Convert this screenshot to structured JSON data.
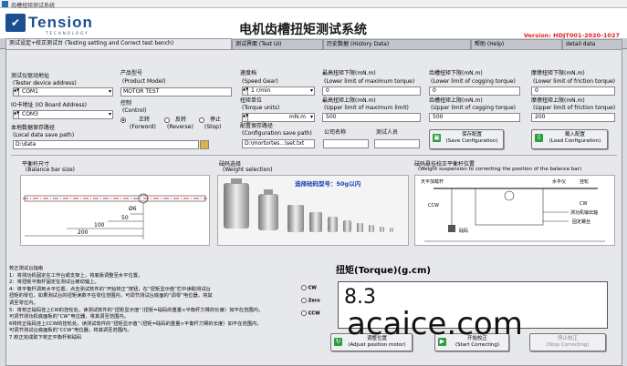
{
  "window": {
    "title": "齿槽扭矩测试系统"
  },
  "header": {
    "logo_text": "Tension",
    "logo_sub": "TECHNOLOGY",
    "app_title": "电机齿槽扭矩测试系统",
    "version": "Version: HDJT001-2020-1027"
  },
  "tabs": [
    {
      "label": "测试设定+校正测试台 (Testing setting and Correct test bench)"
    },
    {
      "label": "测试界面 (Test UI)"
    },
    {
      "label": "历史数据 (History Data)"
    },
    {
      "label": "帮助 (Help)"
    },
    {
      "label": "detail data"
    }
  ],
  "settings": {
    "tester_label_cn": "测试仪驱动地址",
    "tester_label_en": "(Tester device address)",
    "tester_value": "COM1",
    "io_label_cn": "IO卡地址 (IO Board Address)",
    "io_value": "COM3",
    "save_path_label_cn": "本地数据保存路径",
    "save_path_label_en": "(Local data save path)",
    "save_path_value": "D:\\data",
    "product_label": "产品型号",
    "product_label_en": "(Product Model)",
    "product_value": "MOTOR TEST",
    "control_label": "控制",
    "control_label_en": "(Control)",
    "forward_label": "正转",
    "forward_en": "(Forword)",
    "reverse_label": "反转",
    "reverse_en": "(Reverse)",
    "stop_label": "停止",
    "stop_en": "(Stop)",
    "speed_label": "速度档",
    "speed_en": "(Speed Gear)",
    "speed_value": "1 r/min",
    "torque_unit_label": "扭矩单位",
    "torque_unit_en": "(Torque units)",
    "torque_unit_value": "mN.m",
    "config_path_label": "配置保存路径",
    "config_path_en": "(Configuration save path)",
    "config_path_value": "D:\\mortortes...\\set.txt",
    "company_label": "公司名称",
    "tester_person_label": "测试人员",
    "max_lower_label": "最高扭矩下限(mN.m)",
    "max_lower_en": "(Lower limit of maximum torque)",
    "max_lower_value": "0",
    "max_upper_label": "最高扭矩上限(mN.m)",
    "max_upper_en": "(Upper limit of maximum limit)",
    "max_upper_value": "500",
    "cog_lower_label": "齿槽扭矩下限(mN.m)",
    "cog_lower_en": "(Lower limit of cogging torque)",
    "cog_lower_value": "0",
    "cog_upper_label": "齿槽扭矩上限(mN.m)",
    "cog_upper_en": "(Upper limit of cogging torque)",
    "cog_upper_value": "500",
    "fric_lower_label": "摩擦扭矩下限(mN.m)",
    "fric_lower_en": "(Lower limit of friction torque)",
    "fric_lower_value": "0",
    "fric_upper_label": "摩擦扭矩上限(mN.m)",
    "fric_upper_en": "(Upper limit of friction torque)",
    "fric_upper_value": "200",
    "save_config_cn": "保存配置",
    "save_config_en": "(Save Configuration)",
    "load_config_cn": "载入配置",
    "load_config_en": "(Load Configuration)"
  },
  "diagrams": {
    "bar_title_cn": "平衡杆尺寸",
    "bar_title_en": "(Balance bar size)",
    "dim_6": "Ø6",
    "dim_50": "50",
    "dim_100": "100",
    "dim_200": "200",
    "weight_title_cn": "砝码选择",
    "weight_title_en": "(Weight selection)",
    "weight_caption": "选择砝码型号：50g以内",
    "susp_title_cn": "砝码悬挂校正平衡杆位置",
    "susp_title_en": "(Weight suspension to correcting the position of the balance bar)",
    "susp_l1": "天平加载杆",
    "susp_l2": "水平仪",
    "susp_l3": "挂轮",
    "susp_l4": "CCW",
    "susp_l5": "CW",
    "susp_l6": "测功机输出轴",
    "susp_l7": "固定螺丝",
    "susp_l8": "砝码"
  },
  "instructions": {
    "title": "校正测试台指南",
    "lines": [
      "1：将测功机固定在工作台或支架上，将底板调整至水平位置。",
      "2：将扭矩平衡杆固定在测试台被动轴上。",
      "4：将平衡杆调到水平位置，点击测试软件的“开始校正”按钮，在“扭矩显示值”栏中读取测试台",
      "扭矩的零位，如果测试台的扭矩读数不在零位范围内，可调节测试台底面的“调零”电位器，将其",
      "调至零位内。",
      "5：将校正砝码挂上CW的挂轮处，读测试软件的“扭矩显示值”（扭矩=砝码的重量×平衡杆力臂的长度）如不在范围内，",
      "可调节测功机底面板的“CW”电位器，将其调至范围内。",
      "6将校正砝码挂上CCW的挂轮处，读测试软件的“扭矩显示值”（扭矩=砝码的重量×平衡杆力臂的长度）如不在范围内，",
      "可调节测试台底面板的“CCW”电位器，将其调至范围内。",
      "7.校正完成取下校正平衡杆和砝码"
    ]
  },
  "torque": {
    "title": "扭矩(Torque)(g.cm)",
    "value": "8.3",
    "cw": "CW",
    "zero": "Zero",
    "ccw": "CCW"
  },
  "bottom_buttons": {
    "adjust_cn": "调整位置",
    "adjust_en": "(Adjust position motor)",
    "start_cn": "开始校正",
    "start_en": "(Start Correcting)",
    "stop_cn": "停止校正",
    "stop_en": "(Stop Correcting)"
  },
  "watermark": "acaice.com",
  "colors": {
    "accent": "#1b4f8f",
    "version_red": "#dd2222",
    "green": "#2e9d3e"
  }
}
